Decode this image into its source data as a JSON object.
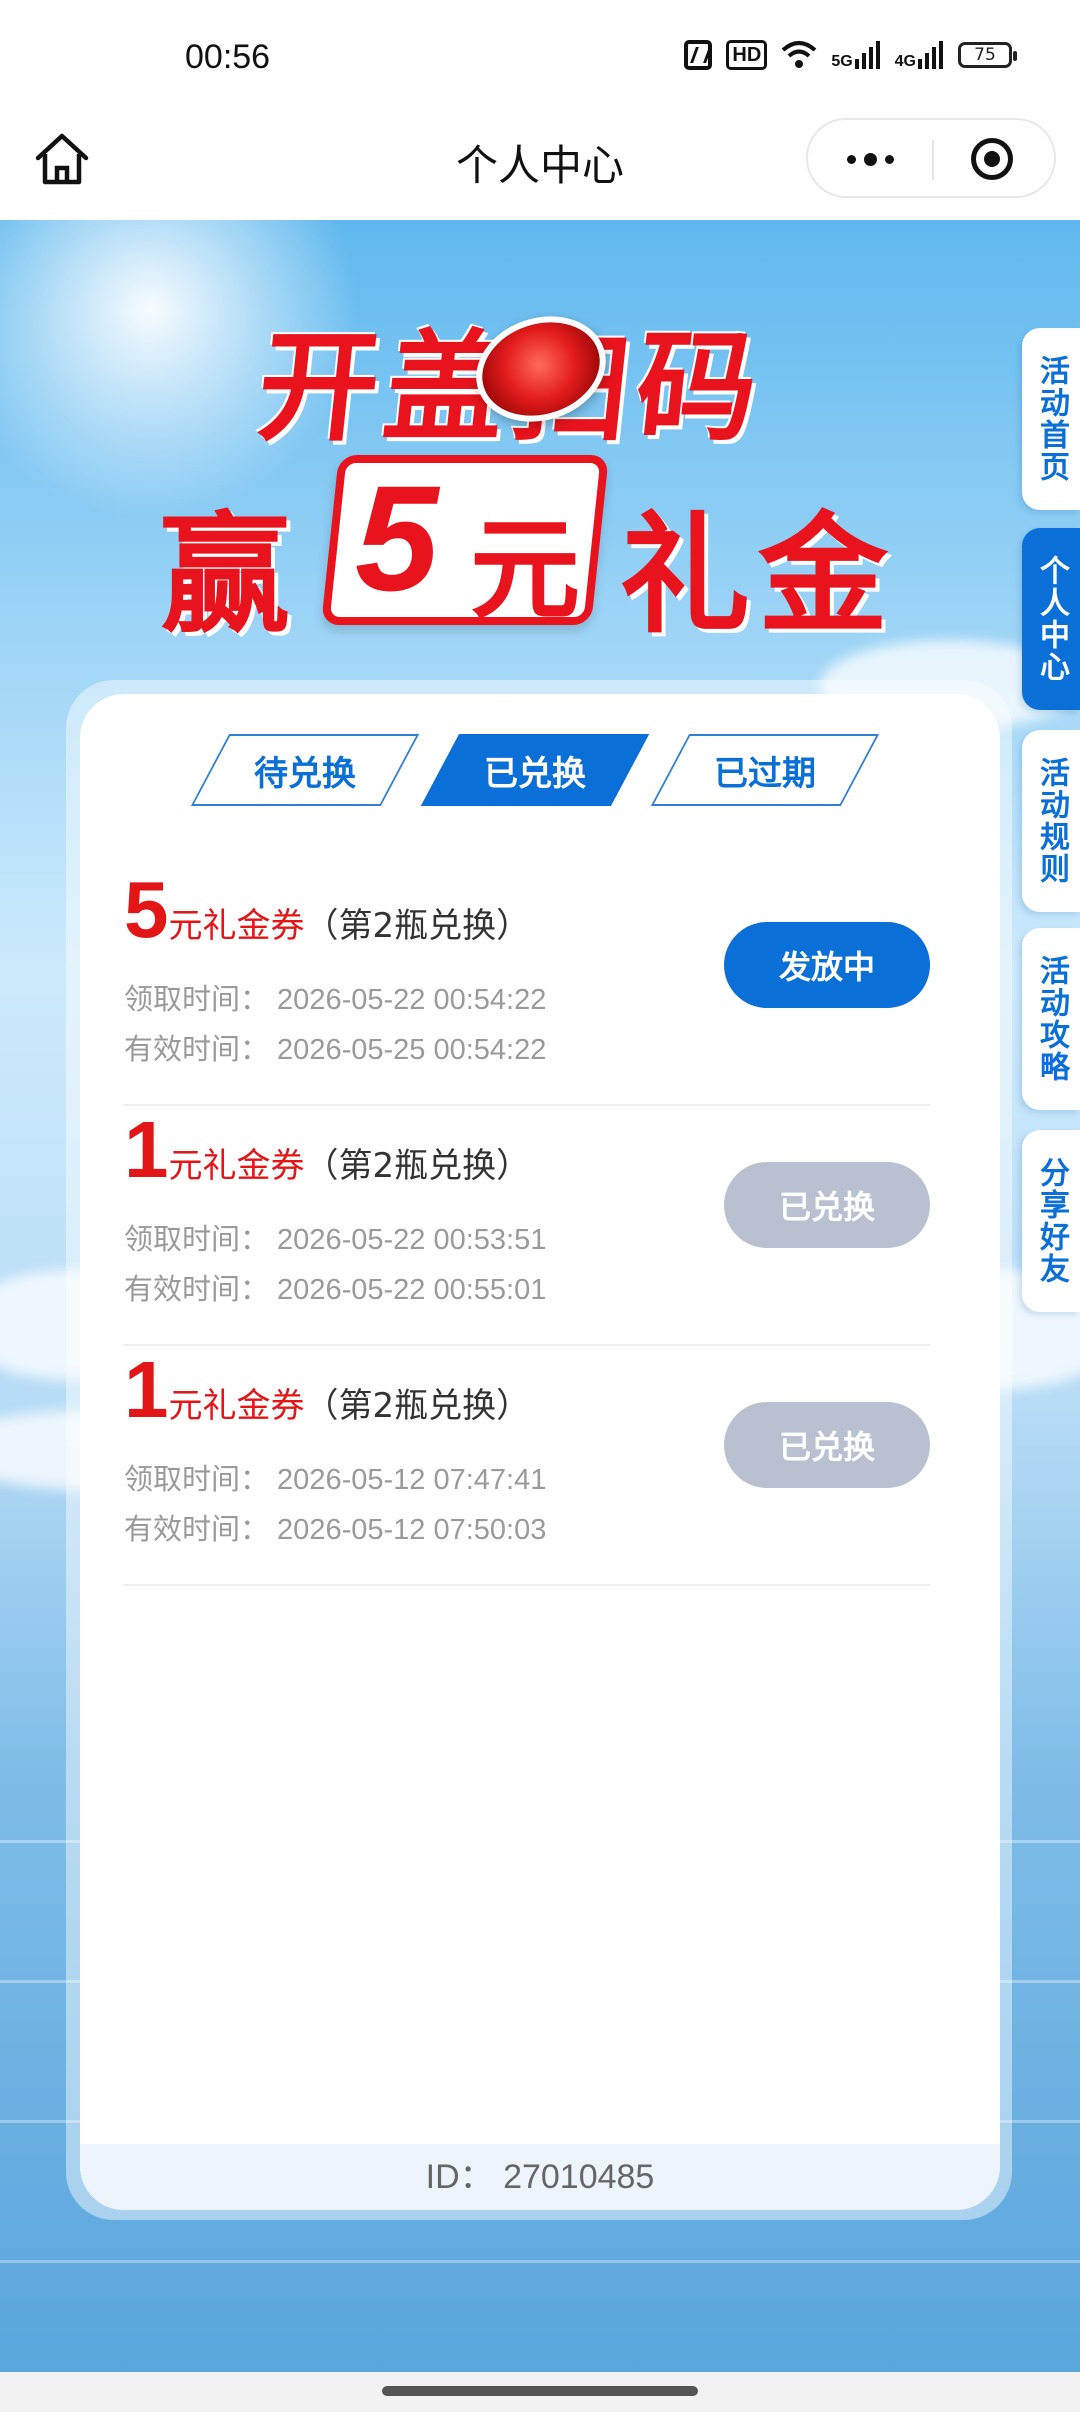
{
  "status_bar": {
    "time": "00:56",
    "signal_5g": "5G",
    "signal_4g": "4G",
    "battery": "75"
  },
  "navbar": {
    "title": "个人中心"
  },
  "banner": {
    "line1": "开盖扫码",
    "prefix": "赢",
    "amount": "5",
    "unit": "元",
    "suffix": "礼金"
  },
  "side_tabs": [
    {
      "label": "活动首页",
      "active": false
    },
    {
      "label": "个人中心",
      "active": true
    },
    {
      "label": "活动规则",
      "active": false
    },
    {
      "label": "活动攻略",
      "active": false
    },
    {
      "label": "分享好友",
      "active": false
    }
  ],
  "tabs": [
    {
      "label": "待兑换",
      "active": false
    },
    {
      "label": "已兑换",
      "active": true
    },
    {
      "label": "已过期",
      "active": false
    }
  ],
  "coupons": [
    {
      "amount": "5",
      "unit": "元礼金券",
      "note": "（第2瓶兑换）",
      "received": "领取时间：  2026-05-22 00:54:22",
      "valid": "有效时间：  2026-05-25 00:54:22",
      "status": "发放中"
    },
    {
      "amount": "1",
      "unit": "元礼金券",
      "note": "（第2瓶兑换）",
      "received": "领取时间：  2026-05-22 00:53:51",
      "valid": "有效时间：  2026-05-22 00:55:01",
      "status": "已兑换"
    },
    {
      "amount": "1",
      "unit": "元礼金券",
      "note": "（第2瓶兑换）",
      "received": "领取时间：  2026-05-12 07:47:41",
      "valid": "有效时间：  2026-05-12 07:50:03",
      "status": "已兑换"
    }
  ],
  "footer": {
    "id_text": "ID：  27010485"
  },
  "colors": {
    "brand_blue": "#0a6fd6",
    "accent_red": "#e21616",
    "disabled_gray": "#b9c1d1"
  }
}
